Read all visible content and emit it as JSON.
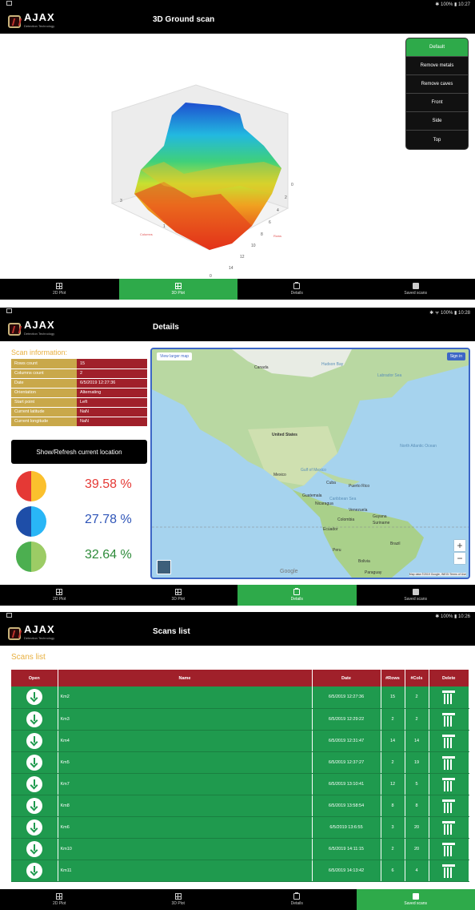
{
  "brand": {
    "name": "AJAX",
    "tagline": "Detection Technology"
  },
  "screen1": {
    "status_time": "✱ 100% ▮ 10:27",
    "title": "3D Ground scan",
    "view_menu": [
      "Default",
      "Remove metals",
      "Remove caves",
      "Front",
      "Side",
      "Top"
    ],
    "active_view": "Default",
    "axis_ticks_right": [
      "0",
      "2",
      "4",
      "6",
      "8",
      "10",
      "12",
      "14"
    ],
    "axis_ticks_left": [
      "3",
      "1"
    ],
    "axis_tick_bottom": "0",
    "axis_label_rows": "Rows",
    "axis_label_cols": "Columns"
  },
  "screen2": {
    "status_time": "✱ ᯤ 100% ▮ 10:28",
    "title": "Details",
    "scan_info_title": "Scan information:",
    "info_rows": [
      {
        "k": "Rows count",
        "v": "15"
      },
      {
        "k": "Columns count",
        "v": "2"
      },
      {
        "k": "Date",
        "v": "6/5/2019 12:27:36"
      },
      {
        "k": "Orientation",
        "v": "Alternating"
      },
      {
        "k": "Start point",
        "v": "Left"
      },
      {
        "k": "Current latitude",
        "v": "NaN"
      },
      {
        "k": "Current longitude",
        "v": "NaN"
      }
    ],
    "location_button": "Show/Refresh current location",
    "percentages": [
      {
        "value": "39.58 %",
        "color": "#e53935",
        "left": "#e53935",
        "right": "#fbc02d"
      },
      {
        "value": "27.78 %",
        "color": "#2f55b8",
        "left": "#1e4ea8",
        "right": "#29b6f6"
      },
      {
        "value": "32.64 %",
        "color": "#2e8b3a",
        "left": "#4caf50",
        "right": "#9ccc65"
      }
    ],
    "map": {
      "larger_map": "View larger map",
      "sign_in": "Sign in",
      "attribution": "Map data ©2019 Google, INEGI   Terms of Use",
      "google": "Google",
      "labels": [
        "Canada",
        "Hudson Bay",
        "Labrador Sea",
        "United States",
        "North Atlantic Ocean",
        "Mexico",
        "Gulf of Mexico",
        "Cuba",
        "Puerto Rico",
        "Guatemala",
        "Nicaragua",
        "Caribbean Sea",
        "Venezuela",
        "Guyana",
        "Suriname",
        "Colombia",
        "Ecuador",
        "Peru",
        "Brazil",
        "Bolivia",
        "Paraguay"
      ]
    }
  },
  "screen3": {
    "status_time": "✱ 100% ▮ 10:26",
    "title": "Scans list",
    "list_title": "Scans list",
    "headers": [
      "Open",
      "Name",
      "Date",
      "#Rows",
      "#Cols",
      "Delete"
    ],
    "rows": [
      {
        "name": "Km2",
        "date": "6/5/2019 12:27:36",
        "rows": "15",
        "cols": "2"
      },
      {
        "name": "Km3",
        "date": "6/5/2019 12:29:22",
        "rows": "2",
        "cols": "2"
      },
      {
        "name": "Km4",
        "date": "6/5/2019 12:31:47",
        "rows": "14",
        "cols": "14"
      },
      {
        "name": "Km5",
        "date": "6/5/2019 12:37:27",
        "rows": "2",
        "cols": "19"
      },
      {
        "name": "Km7",
        "date": "6/5/2019 13:10:41",
        "rows": "12",
        "cols": "5"
      },
      {
        "name": "Km8",
        "date": "6/5/2019 13:58:54",
        "rows": "8",
        "cols": "8"
      },
      {
        "name": "Km6",
        "date": "6/5/2019 13:6:55",
        "rows": "3",
        "cols": "20"
      },
      {
        "name": "Km10",
        "date": "6/5/2019 14:11:15",
        "rows": "2",
        "cols": "20"
      },
      {
        "name": "Km11",
        "date": "6/5/2019 14:13:42",
        "rows": "6",
        "cols": "4"
      }
    ]
  },
  "nav": {
    "items": [
      "2D Plot",
      "3D Plot",
      "Details",
      "Saved scans"
    ],
    "active_screen1": "3D Plot",
    "active_screen2": "Details",
    "active_screen3": "Saved scans"
  }
}
